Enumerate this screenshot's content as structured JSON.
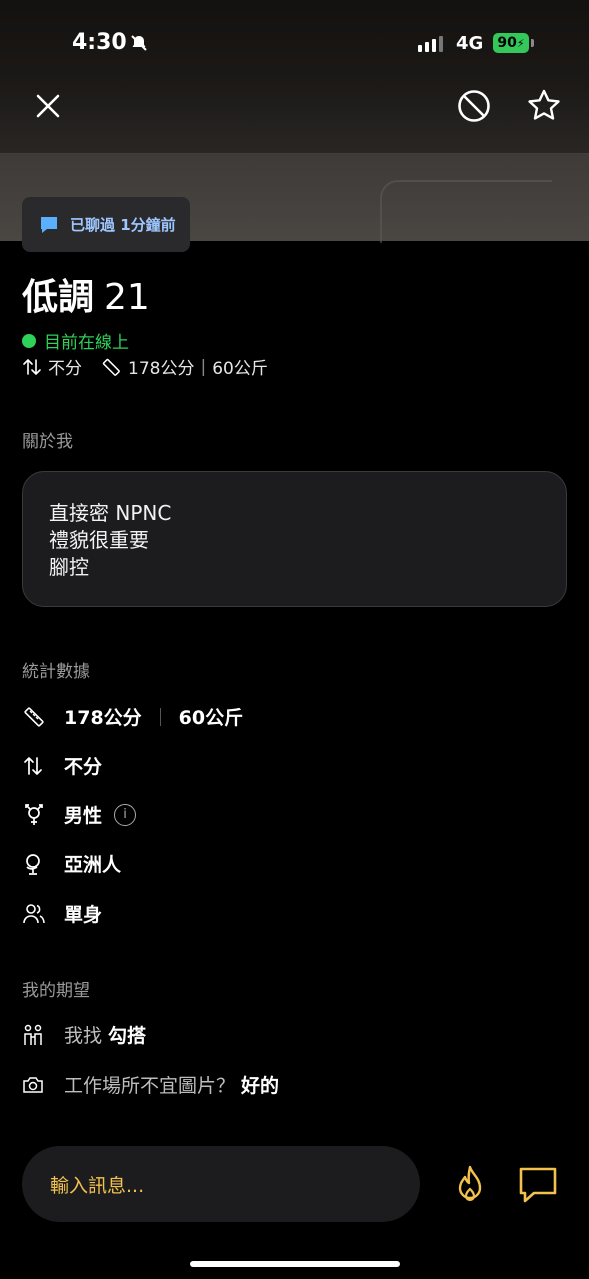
{
  "status_bar": {
    "time": "4:30",
    "network": "4G",
    "battery": "90"
  },
  "last_chat": "已聊過 1分鐘前",
  "profile": {
    "name": "低調",
    "age": "21",
    "online": "目前在線上",
    "position": "不分",
    "height": "178公分",
    "weight": "60公斤"
  },
  "about": {
    "title": "關於我",
    "lines": [
      "直接密 NPNC",
      "禮貌很重要",
      "腳控"
    ]
  },
  "stats": {
    "title": "統計數據",
    "height": "178公分",
    "weight": "60公斤",
    "position": "不分",
    "gender": "男性",
    "ethnicity": "亞洲人",
    "relationship": "單身"
  },
  "expectations": {
    "title": "我的期望",
    "looking_label": "我找",
    "looking_value": "勾搭",
    "nsfw_label": "工作場所不宜圖片？",
    "nsfw_value": "好的"
  },
  "composer": {
    "placeholder": "輸入訊息..."
  },
  "colors": {
    "online": "#30d158",
    "accent": "#f2c14e",
    "chat_text": "#9fc7ff"
  }
}
